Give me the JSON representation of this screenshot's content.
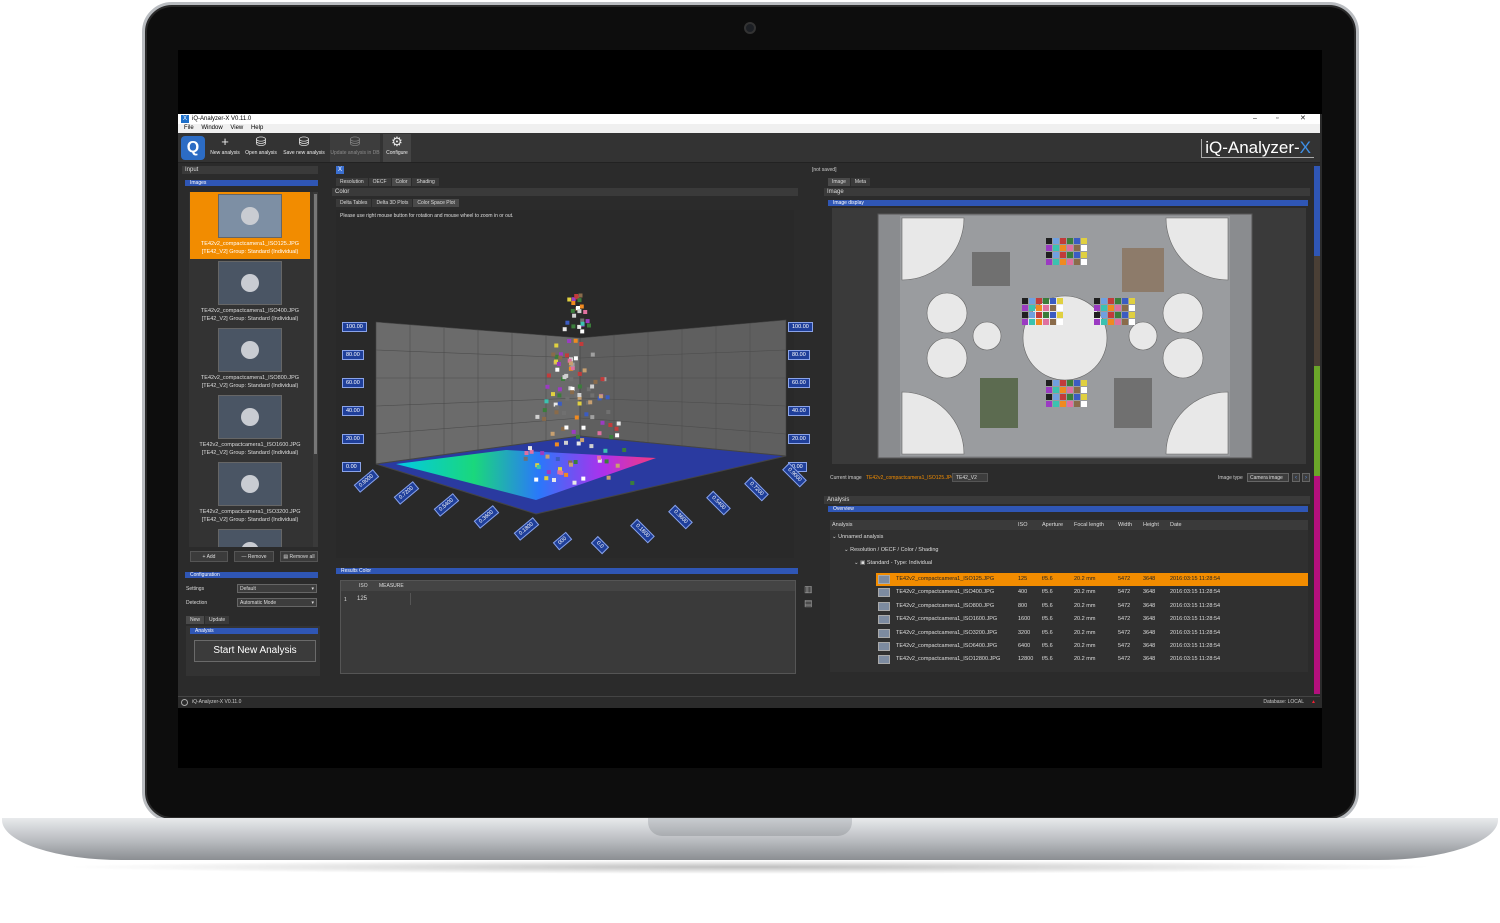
{
  "window": {
    "title": "iQ-Analyzer-X V0.11.0",
    "brand_main": "iQ-Analyzer-",
    "brand_x": "X"
  },
  "menu": [
    "File",
    "Window",
    "View",
    "Help"
  ],
  "toolbar": {
    "new_analysis": "New analysis",
    "open_analysis": "Open analysis",
    "save_new_analysis": "Save new analysis",
    "update_analysis": "Update analysis in DB",
    "configure": "Configure"
  },
  "input_panel": {
    "title": "Input",
    "images_header": "Images",
    "thumbnails": [
      {
        "name": "TE42v2_compactcamera1_ISO125.JPG",
        "group": "[TE42_V2] Group: Standard (Individual)"
      },
      {
        "name": "TE42v2_compactcamera1_ISO400.JPG",
        "group": "[TE42_V2] Group: Standard (Individual)"
      },
      {
        "name": "TE42v2_compactcamera1_ISO800.JPG",
        "group": "[TE42_V2] Group: Standard (Individual)"
      },
      {
        "name": "TE42v2_compactcamera1_ISO1600.JPG",
        "group": "[TE42_V2] Group: Standard (Individual)"
      },
      {
        "name": "TE42v2_compactcamera1_ISO3200.JPG",
        "group": "[TE42_V2] Group: Standard (Individual)"
      }
    ],
    "add_label": "Add",
    "remove_label": "Remove",
    "remove_all_label": "Remove all"
  },
  "configuration": {
    "header": "Configuration",
    "settings_label": "Settings",
    "settings_value": "Default",
    "detection_label": "Detection",
    "detection_value": "Automatic Mode",
    "tab_new": "New",
    "tab_update": "Update",
    "analysis_header": "Analysis",
    "start_button": "Start New Analysis"
  },
  "center": {
    "tabs": [
      "Resolution",
      "OECF",
      "Color",
      "Shading"
    ],
    "panel_title": "Color",
    "subtabs": [
      "Delta Tables",
      "Delta 3D Plots",
      "Color Space Plot"
    ],
    "hint": "Please use right mouse button for rotation and mouse wheel to zoom in or out.",
    "axis_labels_vertical": [
      "100.00",
      "80.00",
      "60.00",
      "40.00",
      "20.00",
      "0.00"
    ],
    "axis_labels_bottom_left": [
      "0.9000",
      "0.7200",
      "0.5400",
      "0.3600",
      "0.1800",
      "000"
    ],
    "axis_labels_bottom_right": [
      "0.0",
      "0.1800",
      "0.3600",
      "0.5400",
      "0.7200",
      "0.9000"
    ],
    "results_title": "Results Color",
    "results_columns": [
      "ISO",
      "MEASURE"
    ],
    "results_row": {
      "index": "1",
      "iso": "125"
    }
  },
  "right": {
    "not_saved": "[not saved]",
    "tabs": [
      "Image",
      "Meta"
    ],
    "panel_title": "Image",
    "display_header": "Image display",
    "current_image_label": "Current image",
    "current_image_value": "TE42v2_compactcamera1_ISO125.JPG",
    "chart_tag": "TE42_V2",
    "image_type_label": "Image type",
    "image_type_value": "Camera image",
    "analysis_title": "Analysis",
    "overview_header": "Overview",
    "columns": [
      "Analysis",
      "ISO",
      "Aperture",
      "Focal length",
      "Width",
      "Height",
      "Date"
    ],
    "tree": {
      "root": "Unnamed analysis",
      "level1": "Resolution / OECF / Color / Shading",
      "level2": "Standard - Type: Individual"
    },
    "rows": [
      {
        "name": "TE42v2_compactcamera1_ISO125.JPG",
        "iso": "125",
        "aperture": "f/5.6",
        "focal": "20.2 mm",
        "width": "5472",
        "height": "3648",
        "date": "2016:03:15 11:28:54"
      },
      {
        "name": "TE42v2_compactcamera1_ISO400.JPG",
        "iso": "400",
        "aperture": "f/5.6",
        "focal": "20.2 mm",
        "width": "5472",
        "height": "3648",
        "date": "2016:03:15 11:28:54"
      },
      {
        "name": "TE42v2_compactcamera1_ISO800.JPG",
        "iso": "800",
        "aperture": "f/5.6",
        "focal": "20.2 mm",
        "width": "5472",
        "height": "3648",
        "date": "2016:03:15 11:28:54"
      },
      {
        "name": "TE42v2_compactcamera1_ISO1600.JPG",
        "iso": "1600",
        "aperture": "f/5.6",
        "focal": "20.2 mm",
        "width": "5472",
        "height": "3648",
        "date": "2016:03:15 11:28:54"
      },
      {
        "name": "TE42v2_compactcamera1_ISO3200.JPG",
        "iso": "3200",
        "aperture": "f/5.6",
        "focal": "20.2 mm",
        "width": "5472",
        "height": "3648",
        "date": "2016:03:15 11:28:54"
      },
      {
        "name": "TE42v2_compactcamera1_ISO6400.JPG",
        "iso": "6400",
        "aperture": "f/5.6",
        "focal": "20.2 mm",
        "width": "5472",
        "height": "3648",
        "date": "2016:03:15 11:28:54"
      },
      {
        "name": "TE42v2_compactcamera1_ISO12800.JPG",
        "iso": "12800",
        "aperture": "f/5.6",
        "focal": "20.2 mm",
        "width": "5472",
        "height": "3648",
        "date": "2016:03:15 11:28:54"
      }
    ]
  },
  "statusbar": {
    "left": "iQ-Analyzer-X V0.11.0",
    "right": "Database: LOCAL"
  },
  "colors": {
    "accent_blue": "#2f56b5",
    "selection_orange": "#f28c00",
    "brand_x": "#3e8fe6"
  }
}
